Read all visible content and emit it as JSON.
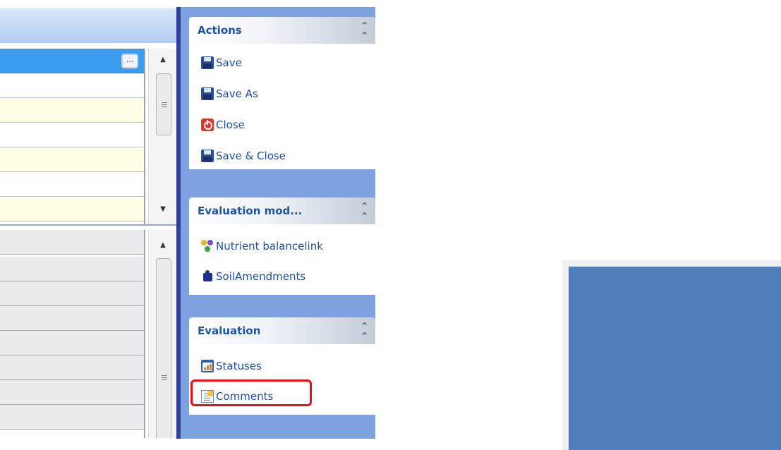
{
  "task_panel": {
    "groups": [
      {
        "title": "Actions",
        "items": [
          {
            "label": "Save",
            "icon": "floppy-disk-icon"
          },
          {
            "label": "Save As",
            "icon": "floppy-disk-icon"
          },
          {
            "label": "Close",
            "icon": "close-power-icon"
          },
          {
            "label": "Save & Close",
            "icon": "floppy-disk-icon"
          }
        ]
      },
      {
        "title": "Evaluation mod...",
        "items": [
          {
            "label": "Nutrient balancelink",
            "icon": "link-nodes-icon"
          },
          {
            "label": "SoilAmendments",
            "icon": "puzzle-icon"
          }
        ]
      },
      {
        "title": "Evaluation",
        "items": [
          {
            "label": "Statuses",
            "icon": "chart-icon"
          },
          {
            "label": "Comments",
            "icon": "document-icon"
          }
        ]
      }
    ],
    "highlighted_item": "Comments",
    "highlight_color": "#e5131a"
  },
  "grid": {
    "ellipsis_button": "...",
    "selected_row_color": "#3c9cf0",
    "alt_row_color": "#fffde4"
  },
  "colors": {
    "panel_background": "#7ea2e0",
    "header_text": "#1c55a9",
    "item_text": "#1b4fb0",
    "blue_block": "#4e7fbb"
  }
}
